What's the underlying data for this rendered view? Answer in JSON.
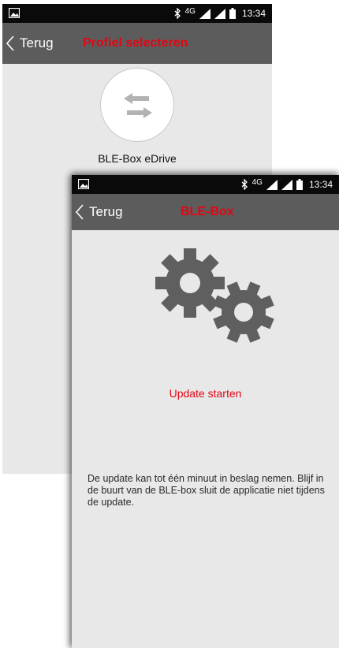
{
  "colors": {
    "accent_red": "#e30613",
    "app_bar": "#5c5c5c",
    "status_bar": "#0a0a0a",
    "content_bg": "#e8e8e8",
    "gear": "#5f5f5f"
  },
  "back_screen": {
    "status_bar": {
      "gallery_icon": "image-icon",
      "network": "4G",
      "time": "13:34"
    },
    "app_bar": {
      "back_label": "Terug",
      "title": "Profiel selecteren"
    },
    "profile": {
      "icon": "swap-arrows-icon",
      "name": "BLE-Box eDrive"
    }
  },
  "front_screen": {
    "status_bar": {
      "gallery_icon": "image-icon",
      "network": "4G",
      "time": "13:34"
    },
    "app_bar": {
      "back_label": "Terug",
      "title": "BLE-Box"
    },
    "icon": "gears-icon",
    "update_label": "Update starten",
    "info_text": "De update kan tot één minuut in beslag nemen. Blijf in de buurt van de BLE-box sluit de applicatie niet tijdens de update."
  }
}
